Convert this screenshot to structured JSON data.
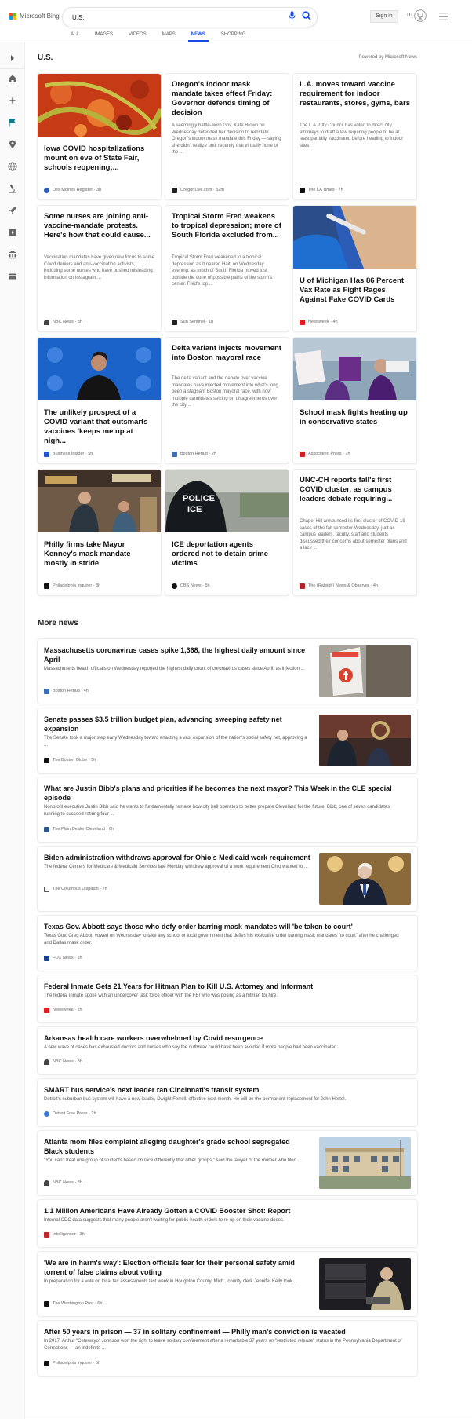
{
  "header": {
    "logo_text": "Microsoft Bing",
    "search_query": "U.S.",
    "signin_label": "Sign in",
    "rewards_count": "10"
  },
  "nav": [
    "ALL",
    "IMAGES",
    "VIDEOS",
    "MAPS",
    "NEWS",
    "SHOPPING"
  ],
  "nav_active": "NEWS",
  "colors": {
    "accent": "#174ae4",
    "bing_red": "#f25022",
    "bing_green": "#7fba00",
    "bing_blue": "#00a4ef",
    "bing_yellow": "#ffb900"
  },
  "rail_icons": [
    "chevron-right-icon",
    "home-icon",
    "sparkle-icon",
    "flag-icon",
    "location-pin-icon",
    "globe-icon",
    "microscope-icon",
    "rocket-icon",
    "video-icon",
    "bank-icon",
    "card-icon"
  ],
  "section": {
    "title": "U.S.",
    "powered_by": "Powered by Microsoft News"
  },
  "cards": [
    {
      "title": "Iowa COVID hospitalizations mount on eve of State Fair, schools reopening;...",
      "snippet": "",
      "source": "Des Moines Register",
      "time": "3h",
      "has_image": true,
      "src_color": "#2f5fb3"
    },
    {
      "title": "Oregon's indoor mask mandate takes effect Friday: Governor defends timing of decision",
      "snippet": "A seemingly battle-worn Gov. Kate Brown on Wednesday defended her decision to reinstate Oregon's indoor mask mandate this Friday — saying she didn't realize until recently that virtually none of the ...",
      "source": "OregonLive.com",
      "time": "52m",
      "has_image": false,
      "src_color": "#222222"
    },
    {
      "title": "L.A. moves toward vaccine requirement for indoor restaurants, stores, gyms, bars",
      "snippet": "The L.A. City Council has voted to direct city attorneys to draft a law requiring people to be at least partially vaccinated before heading to indoor sites.",
      "source": "The LA Times",
      "time": "7h",
      "has_image": false,
      "src_color": "#111111"
    },
    {
      "title": "Some nurses are joining anti-vaccine-mandate protests. Here's how that could cause...",
      "snippet": "Vaccination mandates have given new focus to some Covid deniers and anti-vaccination activists, including some nurses who have pushed misleading information on Instagram ...",
      "source": "NBC News",
      "time": "3h",
      "has_image": false,
      "src_color": "#444444"
    },
    {
      "title": "Tropical Storm Fred weakens to tropical depression; more of South Florida excluded from...",
      "snippet": "Tropical Storm Fred weakened to a tropical depression as it neared Haiti on Wednesday evening, as much of South Florida moved just outside the cone of possible paths of the storm's center. Fred's top ...",
      "source": "Sun Sentinel",
      "time": "1h",
      "has_image": false,
      "src_color": "#222222"
    },
    {
      "title": "U of Michigan Has 86 Percent Vax Rate as Fight Rages Against Fake COVID Cards",
      "snippet": "",
      "source": "Newsweek",
      "time": "4h",
      "has_image": true,
      "src_color": "#e31b23"
    },
    {
      "title": "The unlikely prospect of a COVID variant that outsmarts vaccines 'keeps me up at nigh...",
      "snippet": "",
      "source": "Business Insider",
      "time": "5h",
      "has_image": true,
      "src_color": "#2355d6"
    },
    {
      "title": "Delta variant injects movement into Boston mayoral race",
      "snippet": "The delta variant and the debate over vaccine mandates have injected movement into what's long been a stagnant Boston mayoral race, with now multiple candidates seizing on disagreements over the city ...",
      "source": "Boston Herald",
      "time": "2h",
      "has_image": false,
      "src_color": "#3a6fb8"
    },
    {
      "title": "School mask fights heating up in conservative states",
      "snippet": "",
      "source": "Associated Press",
      "time": "7h",
      "has_image": true,
      "src_color": "#d21f26"
    },
    {
      "title": "Philly firms take Mayor Kenney's mask mandate mostly in stride",
      "snippet": "",
      "source": "Philadelphia Inquirer",
      "time": "3h",
      "has_image": true,
      "src_color": "#111111"
    },
    {
      "title": "ICE deportation agents ordered not to detain crime victims",
      "snippet": "",
      "source": "CBS News",
      "time": "5h",
      "has_image": true,
      "src_color": "#111111"
    },
    {
      "title": "UNC-CH reports fall's first COVID cluster, as campus leaders debate requiring...",
      "snippet": "Chapel Hill announced its first cluster of COVID-19 cases of the fall semester Wednesday, just as campus leaders, faculty, staff and students discussed their concerns about semester plans and a lack ...",
      "source": "The (Raleigh) News & Observer",
      "time": "4h",
      "has_image": false,
      "src_color": "#b5232a"
    }
  ],
  "more_news_title": "More news",
  "rows": [
    {
      "title": "Massachusetts coronavirus cases spike 1,368, the highest daily amount since April",
      "snippet": "Massachusetts health officials on Wednesday reported the highest daily count of coronavirus cases since April, as infection ...",
      "source": "Boston Herald",
      "time": "4h",
      "has_image": true,
      "src_color": "#3a6fb8"
    },
    {
      "title": "Senate passes $3.5 trillion budget plan, advancing sweeping safety net expansion",
      "snippet": "The Senate took a major step early Wednesday toward enacting a vast expansion of the nation's social safety net, approving a ...",
      "source": "The Boston Globe",
      "time": "5h",
      "has_image": true,
      "src_color": "#111111"
    },
    {
      "title": "What are Justin Bibb's plans and priorities if he becomes the next mayor? This Week in the CLE special episode",
      "snippet": "Nonprofit executive Justin Bibb said he wants to fundamentally remake how city hall operates to better prepare Cleveland for the future. Bibb, one of seven candidates running to succeed retiring four ...",
      "source": "The Plain Dealer Cleveland",
      "time": "6h",
      "has_image": false,
      "src_color": "#2e5a8c"
    },
    {
      "title": "Biden administration withdraws approval for Ohio's Medicaid work requirement",
      "snippet": "The federal Centers for Medicare & Medicaid Services late Monday withdrew approval of a work requirement Ohio wanted to ...",
      "source": "The Columbus Dispatch",
      "time": "7h",
      "has_image": true,
      "src_color": "#555555"
    },
    {
      "title": "Texas Gov. Abbott says those who defy order barring mask mandates will 'be taken to court'",
      "snippet": "Texas Gov. Greg Abbott vowed on Wednesday to take any school or local government that defies his executive order barring mask mandates \"to court\" after he challenged and Dallas mask order.",
      "source": "FOX News",
      "time": "1h",
      "has_image": false,
      "src_color": "#1b3f8f"
    },
    {
      "title": "Federal Inmate Gets 21 Years for Hitman Plan to Kill U.S. Attorney and Informant",
      "snippet": "The federal inmate spoke with an undercover task force officer with the FBI who was posing as a hitman for hire.",
      "source": "Newsweek",
      "time": "2h",
      "has_image": false,
      "src_color": "#e31b23"
    },
    {
      "title": "Arkansas health care workers overwhelmed by Covid resurgence",
      "snippet": "A new wave of cases has exhausted doctors and nurses who say the outbreak could have been avoided if more people had been vaccinated.",
      "source": "NBC News",
      "time": "3h",
      "has_image": false,
      "src_color": "#444444"
    },
    {
      "title": "SMART bus service's next leader ran Cincinnati's transit system",
      "snippet": "Detroit's suburban bus system will have a new leader, Dwight Ferrell, effective next month. He will be the permanent replacement for John Hertel.",
      "source": "Detroit Free Press",
      "time": "2h",
      "has_image": false,
      "src_color": "#3a7bd5"
    },
    {
      "title": "Atlanta mom files complaint alleging daughter's grade school segregated Black students",
      "snippet": "\"You can't treat one group of students based on race differently that other groups,\" said the lawyer of the mother who filed ...",
      "source": "NBC News",
      "time": "3h",
      "has_image": true,
      "src_color": "#444444"
    },
    {
      "title": "1.1 Million Americans Have Already Gotten a COVID Booster Shot: Report",
      "snippet": "Internal CDC data suggests that many people aren't waiting for public-health orders to re-up on their vaccine doses.",
      "source": "Intelligencer",
      "time": "3h",
      "has_image": false,
      "src_color": "#c4262e"
    },
    {
      "title": "'We are in harm's way': Election officials fear for their personal safety amid torrent of false claims about voting",
      "snippet": "In preparation for a vote on local tax assessments last week in Houghton County, Mich., county clerk Jennifer Kelly took ...",
      "source": "The Washington Post",
      "time": "6h",
      "has_image": true,
      "src_color": "#111111"
    },
    {
      "title": "After 50 years in prison — 37 in solitary confinement — Philly man's conviction is vacated",
      "snippet": "In 2017, Arthur \"Cetewayo\" Johnson won the right to leave solitary confinement after a remarkable 37 years on \"restricted release\" status in the Pennsylvania Department of Corrections — an indefinite ...",
      "source": "Philadelphia Inquirer",
      "time": "5h",
      "has_image": false,
      "src_color": "#111111"
    }
  ]
}
